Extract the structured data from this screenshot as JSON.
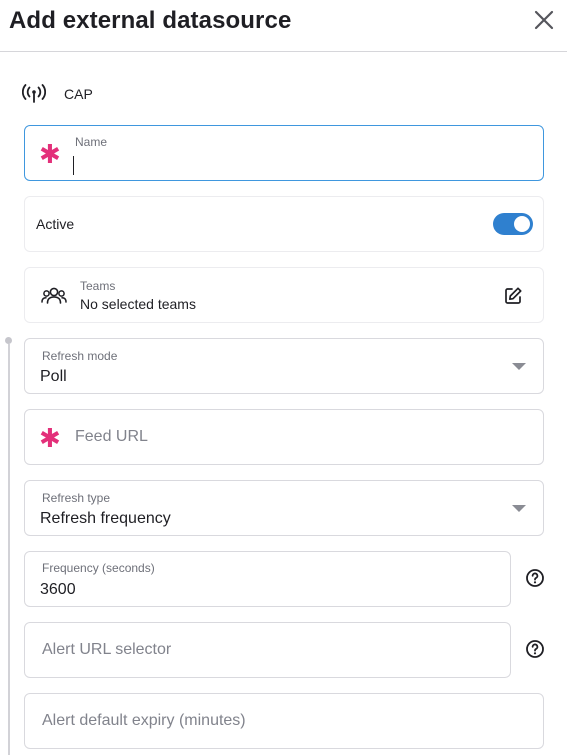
{
  "header": {
    "title": "Add external datasource",
    "close_icon": "close-icon"
  },
  "source": {
    "icon": "antenna-icon",
    "label": "CAP"
  },
  "name_field": {
    "label": "Name",
    "value": "",
    "required": true
  },
  "active": {
    "label": "Active",
    "enabled": true
  },
  "teams": {
    "icon": "users-icon",
    "label": "Teams",
    "value": "No selected teams",
    "edit_icon": "edit-icon"
  },
  "refresh_mode": {
    "label": "Refresh mode",
    "value": "Poll"
  },
  "feed_url": {
    "placeholder": "Feed URL",
    "required": true
  },
  "refresh_type": {
    "label": "Refresh type",
    "value": "Refresh frequency"
  },
  "frequency": {
    "label": "Frequency (seconds)",
    "value": "3600"
  },
  "alert_url_selector": {
    "placeholder": "Alert URL selector"
  },
  "alert_default_expiry": {
    "placeholder": "Alert default expiry (minutes)"
  },
  "colors": {
    "accent": "#2f80cf",
    "required": "#e3307a",
    "focus_border": "#3f97de"
  }
}
